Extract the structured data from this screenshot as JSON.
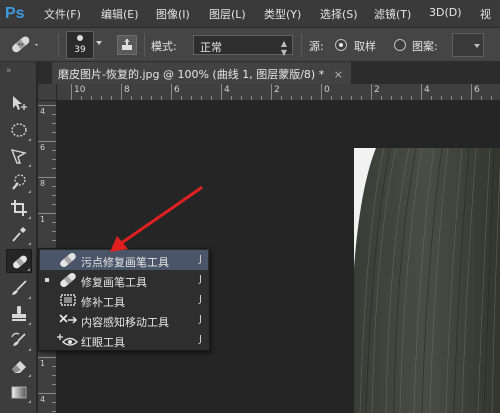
{
  "app": {
    "logo": "Ps"
  },
  "menu": [
    "文件(F)",
    "编辑(E)",
    "图像(I)",
    "图层(L)",
    "类型(Y)",
    "选择(S)",
    "滤镜(T)",
    "3D(D)",
    "视"
  ],
  "options": {
    "brush_size": "39",
    "mode_label": "模式:",
    "mode_value": "正常",
    "source_label": "源:",
    "source_sampled": "取样",
    "source_pattern": "图案:"
  },
  "document": {
    "tab_title": "磨皮图片-恢复的.jpg @ 100% (曲线 1, 图层蒙版/8) *",
    "close_glyph": "×"
  },
  "ruler": {
    "top_labels": [
      "10",
      "8",
      "6",
      "4",
      "2",
      "0",
      "2",
      "4",
      "6",
      "8"
    ],
    "left_labels": [
      "4",
      "6",
      "8",
      "1",
      "0",
      "1",
      "2",
      "1",
      "4"
    ]
  },
  "flyout": {
    "items": [
      {
        "label": "污点修复画笔工具",
        "shortcut": "J",
        "icon": "spot-healing-brush-icon",
        "highlighted": true,
        "current": false
      },
      {
        "label": "修复画笔工具",
        "shortcut": "J",
        "icon": "healing-brush-icon",
        "highlighted": false,
        "current": true
      },
      {
        "label": "修补工具",
        "shortcut": "J",
        "icon": "patch-tool-icon",
        "highlighted": false,
        "current": false
      },
      {
        "label": "内容感知移动工具",
        "shortcut": "J",
        "icon": "content-aware-move-icon",
        "highlighted": false,
        "current": false
      },
      {
        "label": "红眼工具",
        "shortcut": "J",
        "icon": "red-eye-icon",
        "highlighted": false,
        "current": false
      }
    ]
  },
  "tools": [
    "move-tool-icon",
    "marquee-tool-icon",
    "lasso-tool-icon",
    "quick-select-tool-icon",
    "crop-tool-icon",
    "eyedropper-tool-icon",
    "healing-brush-tool-icon",
    "brush-tool-icon",
    "clone-stamp-tool-icon",
    "history-brush-tool-icon",
    "eraser-tool-icon",
    "gradient-tool-icon"
  ],
  "colors": {
    "ps_blue": "#3d9be0",
    "highlight": "#4b5569",
    "annotation_arrow": "#e02020"
  }
}
